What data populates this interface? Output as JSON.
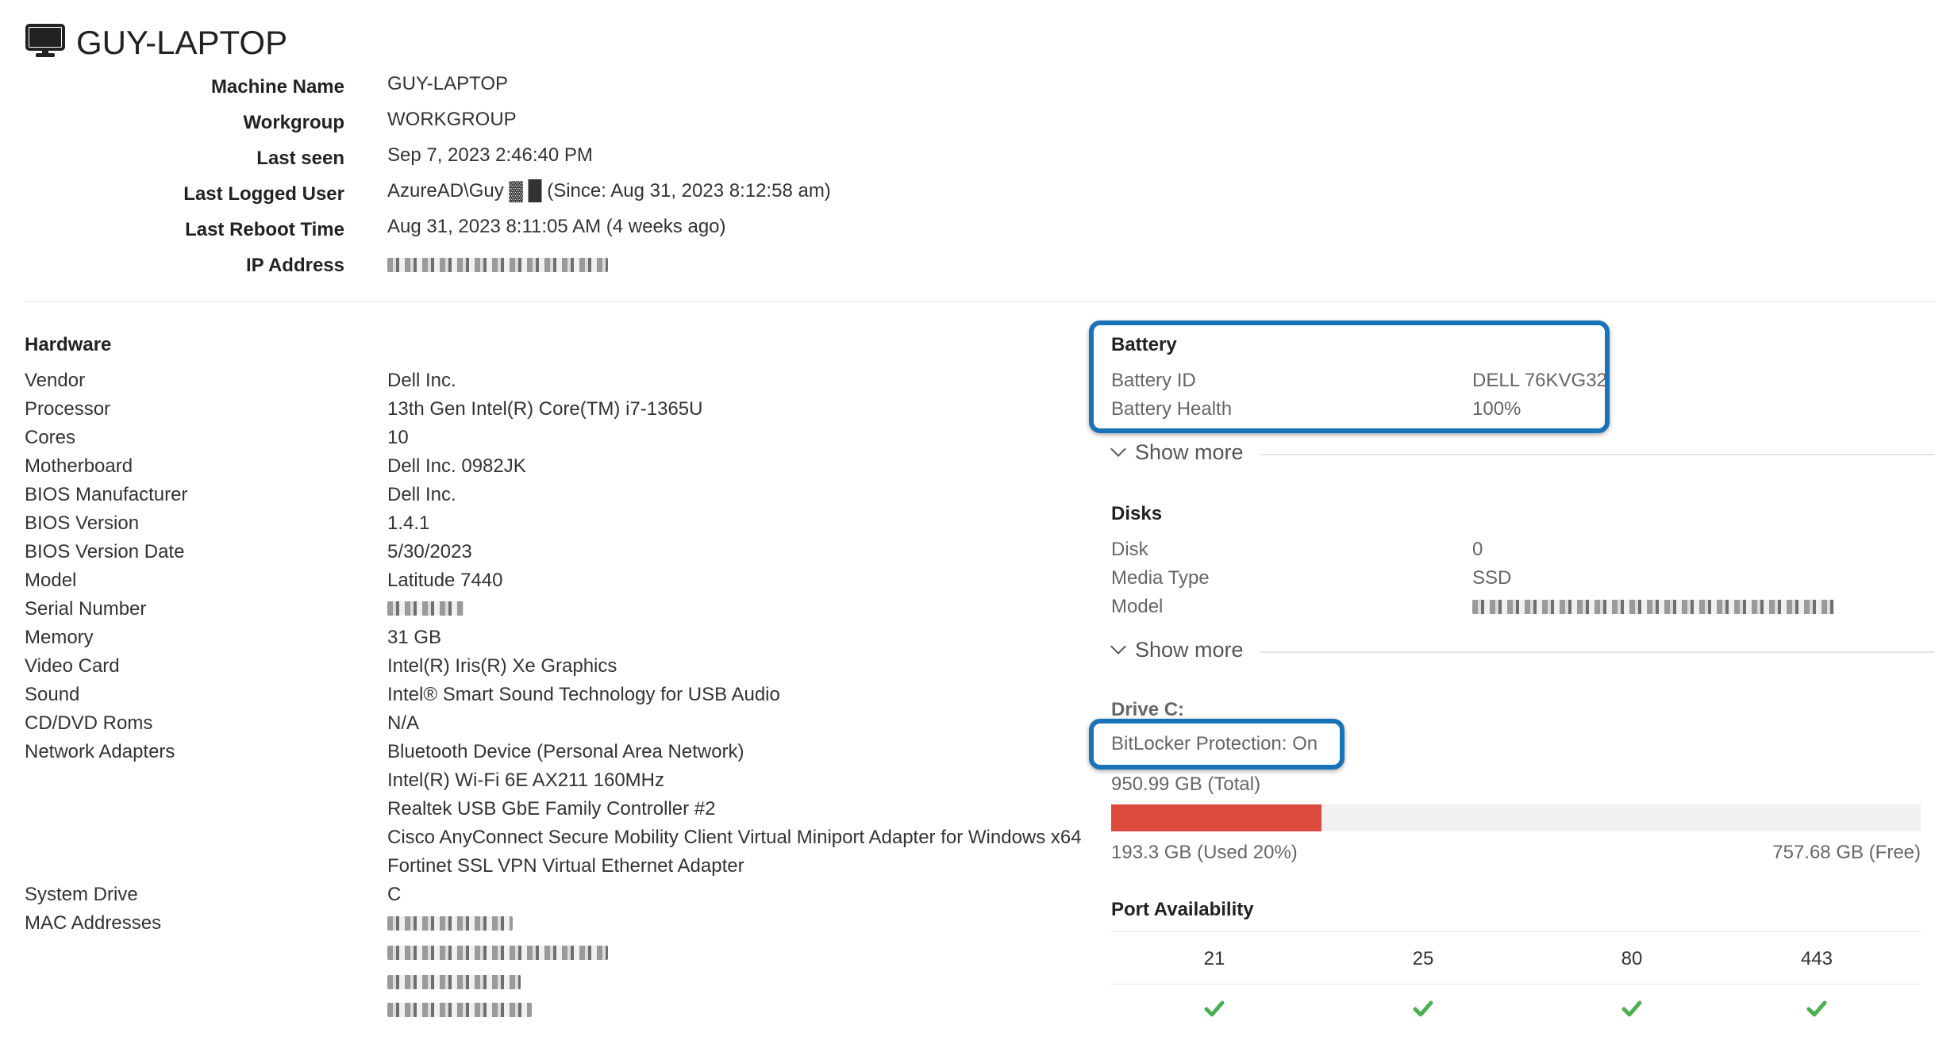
{
  "header": {
    "title": "GUY-LAPTOP",
    "icon": "monitor-icon"
  },
  "summary": [
    {
      "label": "Machine Name",
      "value": "GUY-LAPTOP"
    },
    {
      "label": "Workgroup",
      "value": "WORKGROUP"
    },
    {
      "label": "Last seen",
      "value": "Sep 7, 2023 2:46:40 PM"
    },
    {
      "label": "Last Logged User",
      "value": "AzureAD\\Guy ▓ █ (Since: Aug 31, 2023 8:12:58 am)"
    },
    {
      "label": "Last Reboot Time",
      "value": "Aug 31, 2023 8:11:05 AM (4 weeks ago)"
    },
    {
      "label": "IP Address",
      "value": ""
    }
  ],
  "hardware": {
    "title": "Hardware",
    "rows": [
      {
        "label": "Vendor",
        "value": "Dell Inc."
      },
      {
        "label": "Processor",
        "value": "13th Gen Intel(R) Core(TM) i7-1365U"
      },
      {
        "label": "Cores",
        "value": "10"
      },
      {
        "label": "Motherboard",
        "value": "Dell Inc. 0982JK"
      },
      {
        "label": "BIOS Manufacturer",
        "value": "Dell Inc."
      },
      {
        "label": "BIOS Version",
        "value": "1.4.1"
      },
      {
        "label": "BIOS Version Date",
        "value": "5/30/2023"
      },
      {
        "label": "Model",
        "value": "Latitude 7440"
      },
      {
        "label": "Serial Number",
        "value": ""
      },
      {
        "label": "Memory",
        "value": "31 GB"
      },
      {
        "label": "Video Card",
        "value": "Intel(R) Iris(R) Xe Graphics"
      },
      {
        "label": "Sound",
        "value": "Intel® Smart Sound Technology for USB Audio"
      },
      {
        "label": "CD/DVD Roms",
        "value": "N/A"
      },
      {
        "label": "Network Adapters",
        "value": "Bluetooth Device (Personal Area Network)"
      }
    ],
    "network_extra": [
      "Intel(R) Wi-Fi 6E AX211 160MHz",
      "Realtek USB GbE Family Controller #2",
      "Cisco AnyConnect Secure Mobility Client Virtual Miniport Adapter for Windows x64",
      "Fortinet SSL VPN Virtual Ethernet Adapter"
    ],
    "system_drive": {
      "label": "System Drive",
      "value": "C"
    },
    "mac_addresses": {
      "label": "MAC Addresses"
    }
  },
  "battery": {
    "title": "Battery",
    "rows": [
      {
        "label": "Battery ID",
        "value": "DELL 76KVG32"
      },
      {
        "label": "Battery Health",
        "value": "100%"
      }
    ],
    "show_more": "Show more"
  },
  "disks": {
    "title": "Disks",
    "rows": [
      {
        "label": "Disk",
        "value": "0"
      },
      {
        "label": "Media Type",
        "value": "SSD"
      },
      {
        "label": "Model",
        "value": ""
      }
    ],
    "show_more": "Show more"
  },
  "drive": {
    "title": "Drive C:",
    "bitlocker": "BitLocker Protection: On",
    "total": "950.99 GB (Total)",
    "used": "193.3 GB (Used 20%)",
    "free": "757.68 GB (Free)",
    "used_fraction": 0.2,
    "bar_color": "#dc4a3d"
  },
  "ports": {
    "title": "Port Availability",
    "items": [
      {
        "port": "21",
        "status": "check-icon"
      },
      {
        "port": "25",
        "status": "check-icon"
      },
      {
        "port": "80",
        "status": "check-icon"
      },
      {
        "port": "443",
        "status": "check-icon"
      }
    ],
    "check_color": "#4caf50"
  },
  "colors": {
    "highlight": "#1a72b8",
    "used_bar": "#dc4a3d",
    "check": "#4caf50"
  }
}
